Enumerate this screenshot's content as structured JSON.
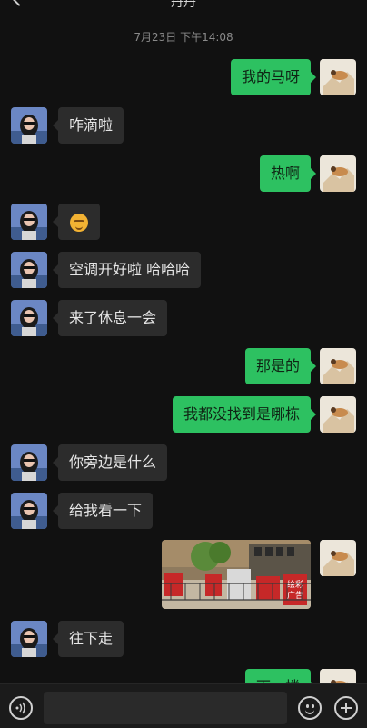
{
  "header": {
    "title": "丹丹",
    "timestamp": "7月23日 下午14:08"
  },
  "messages": [
    {
      "side": "out",
      "text": "我的马呀"
    },
    {
      "side": "in",
      "text": "咋滴啦"
    },
    {
      "side": "out",
      "text": "热啊"
    },
    {
      "side": "in",
      "emoji": "smiling-face"
    },
    {
      "side": "in",
      "text": "空调开好啦 哈哈哈"
    },
    {
      "side": "in",
      "text": "来了休息一会"
    },
    {
      "side": "out",
      "text": "那是的"
    },
    {
      "side": "out",
      "text": "我都没找到是哪栋"
    },
    {
      "side": "in",
      "text": "你旁边是什么"
    },
    {
      "side": "in",
      "text": "给我看一下"
    },
    {
      "side": "out",
      "image": "photo of building entrance with red signs",
      "sign_texts": [
        "绘彩",
        "广告"
      ]
    },
    {
      "side": "in",
      "text": "往下走"
    },
    {
      "side": "out",
      "text": "下一楼"
    }
  ],
  "bottom": {
    "voice_icon": "voice-icon",
    "emoji_icon": "emoji-icon",
    "plus_icon": "plus-icon"
  },
  "colors": {
    "out_bubble": "#2dc161",
    "in_bubble": "#2c2c2c",
    "background": "#111111"
  }
}
